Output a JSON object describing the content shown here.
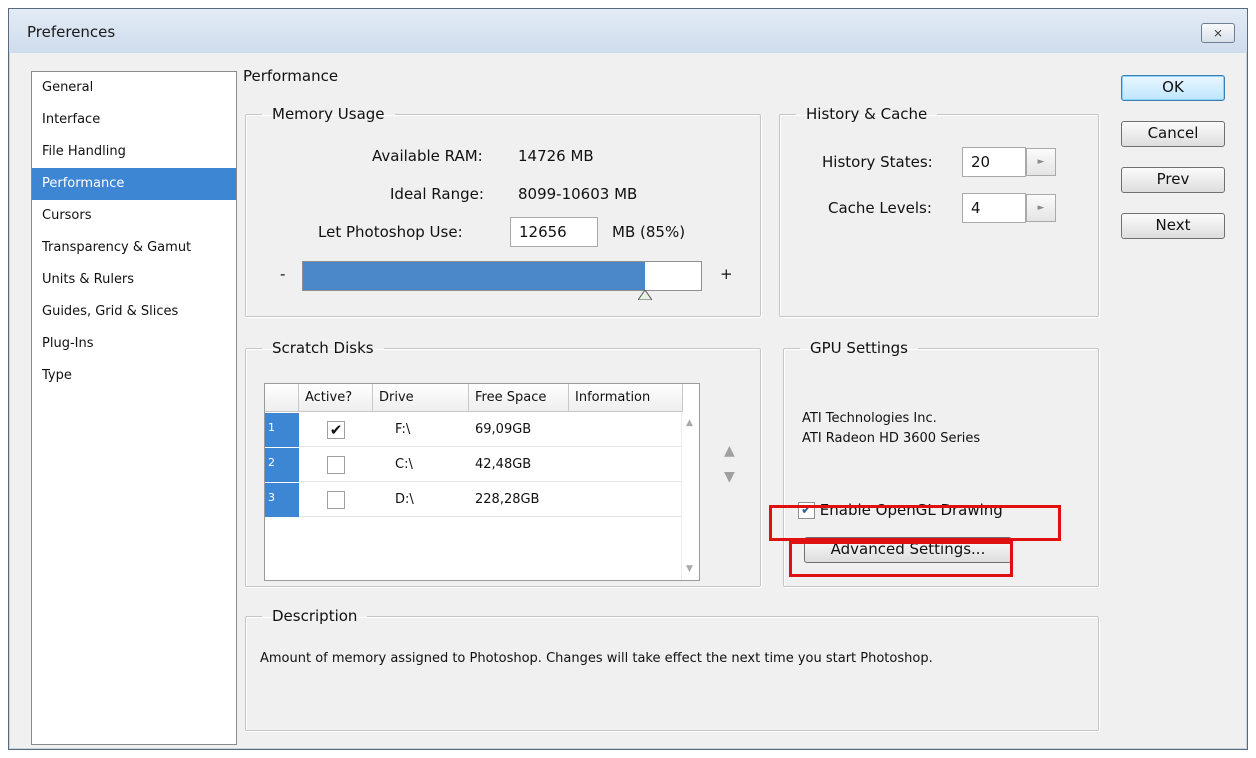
{
  "window": {
    "title": "Preferences",
    "close_glyph": "⨯"
  },
  "nav": {
    "items": [
      {
        "label": "General"
      },
      {
        "label": "Interface"
      },
      {
        "label": "File Handling"
      },
      {
        "label": "Performance",
        "selected": true
      },
      {
        "label": "Cursors"
      },
      {
        "label": "Transparency & Gamut"
      },
      {
        "label": "Units & Rulers"
      },
      {
        "label": "Guides, Grid & Slices"
      },
      {
        "label": "Plug-Ins"
      },
      {
        "label": "Type"
      }
    ]
  },
  "section_title": "Performance",
  "memory": {
    "legend": "Memory Usage",
    "available_label": "Available RAM:",
    "available_value": "14726 MB",
    "ideal_label": "Ideal Range:",
    "ideal_value": "8099-10603 MB",
    "let_label": "Let Photoshop Use:",
    "let_value": "12656",
    "let_suffix": "MB (85%)",
    "slider_minus": "-",
    "slider_plus": "+",
    "slider_fraction": 0.86
  },
  "history": {
    "legend": "History & Cache",
    "states_label": "History States:",
    "states_value": "20",
    "cache_label": "Cache Levels:",
    "cache_value": "4",
    "spin_glyph": "►"
  },
  "scratch": {
    "legend": "Scratch Disks",
    "headers": [
      "Active?",
      "Drive",
      "Free Space",
      "Information"
    ],
    "rows": [
      {
        "num": "1",
        "active": true,
        "check": "✔",
        "drive": "F:\\",
        "free": "69,09GB"
      },
      {
        "num": "2",
        "active": false,
        "check": "",
        "drive": "C:\\",
        "free": "42,48GB"
      },
      {
        "num": "3",
        "active": false,
        "check": "",
        "drive": "D:\\",
        "free": "228,28GB"
      }
    ],
    "up_glyph": "▲",
    "down_glyph": "▼"
  },
  "gpu": {
    "legend": "GPU Settings",
    "vendor": "ATI Technologies Inc.",
    "model": "ATI Radeon HD 3600 Series",
    "opengl_label": "Enable OpenGL Drawing",
    "opengl_check": "✔",
    "advanced_label": "Advanced Settings...",
    "highlight_color": "#e01010"
  },
  "description": {
    "legend": "Description",
    "text": "Amount of memory assigned to Photoshop. Changes will take effect the next time you start Photoshop."
  },
  "buttons": {
    "ok": "OK",
    "cancel": "Cancel",
    "prev": "Prev",
    "next": "Next"
  },
  "colors": {
    "selection": "#3c86d4",
    "slider_fill": "#4a88c9"
  }
}
